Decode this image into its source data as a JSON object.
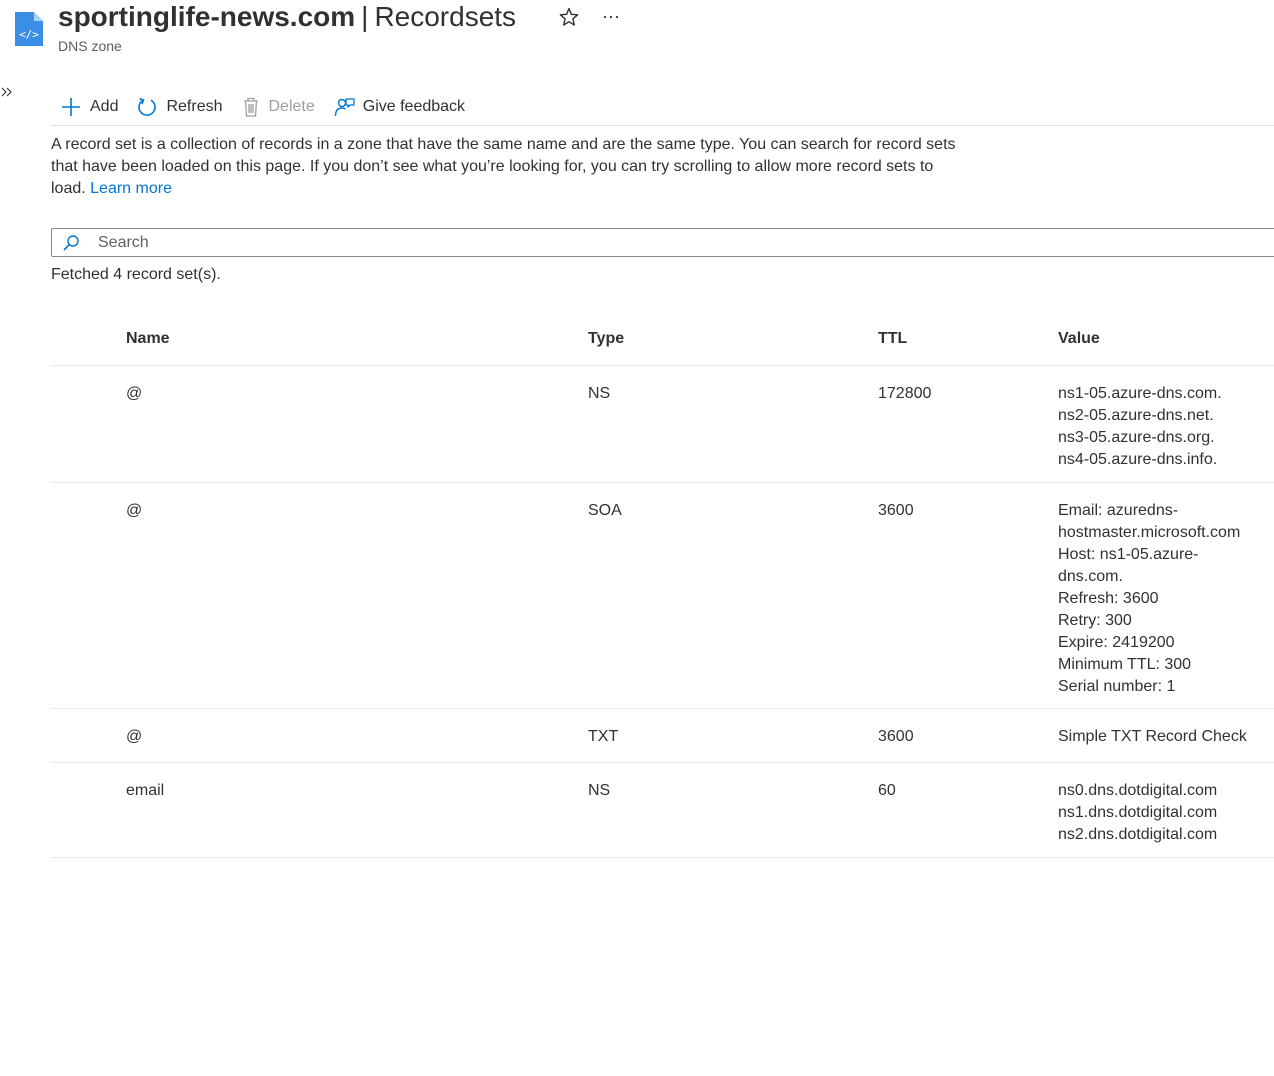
{
  "header": {
    "resource_name": "sportinglife-news.com",
    "separator": "|",
    "section": "Recordsets",
    "subtitle": "DNS zone",
    "icons": {
      "resource": "dns-zone-file-icon",
      "favorite": "star-icon",
      "more": "more-icon",
      "expand": "expand-icon"
    }
  },
  "toolbar": {
    "add_label": "Add",
    "refresh_label": "Refresh",
    "delete_label": "Delete",
    "feedback_label": "Give feedback"
  },
  "description": {
    "text": "A record set is a collection of records in a zone that have the same name and are the same type. You can search for record sets that have been loaded on this page. If you don’t see what you’re looking for, you can try scrolling to allow more record sets to load.",
    "link_label": "Learn more"
  },
  "search": {
    "placeholder": "Search",
    "value": ""
  },
  "status": {
    "fetched_text": "Fetched 4 record set(s)."
  },
  "table": {
    "columns": {
      "name": "Name",
      "type": "Type",
      "ttl": "TTL",
      "value": "Value"
    },
    "rows": [
      {
        "name": "@",
        "type": "NS",
        "ttl": "172800",
        "value_lines": [
          "ns1-05.azure-dns.com.",
          "ns2-05.azure-dns.net.",
          "ns3-05.azure-dns.org.",
          "ns4-05.azure-dns.info."
        ]
      },
      {
        "name": "@",
        "type": "SOA",
        "ttl": "3600",
        "value_lines": [
          "Email: azuredns-",
          "hostmaster.microsoft.com",
          "Host: ns1-05.azure-",
          "dns.com.",
          "Refresh: 3600",
          "Retry: 300",
          "Expire: 2419200",
          "Minimum TTL: 300",
          "Serial number: 1"
        ]
      },
      {
        "name": "@",
        "type": "TXT",
        "ttl": "3600",
        "value_lines": [
          "Simple TXT Record Check"
        ]
      },
      {
        "name": "email",
        "type": "NS",
        "ttl": "60",
        "value_lines": [
          "ns0.dns.dotdigital.com",
          "ns1.dns.dotdigital.com",
          "ns2.dns.dotdigital.com"
        ]
      }
    ]
  },
  "colors": {
    "accent": "#0078d4",
    "text": "#323130",
    "muted": "#605e5c",
    "disabled": "#a19f9d",
    "divider": "#edebe9"
  }
}
